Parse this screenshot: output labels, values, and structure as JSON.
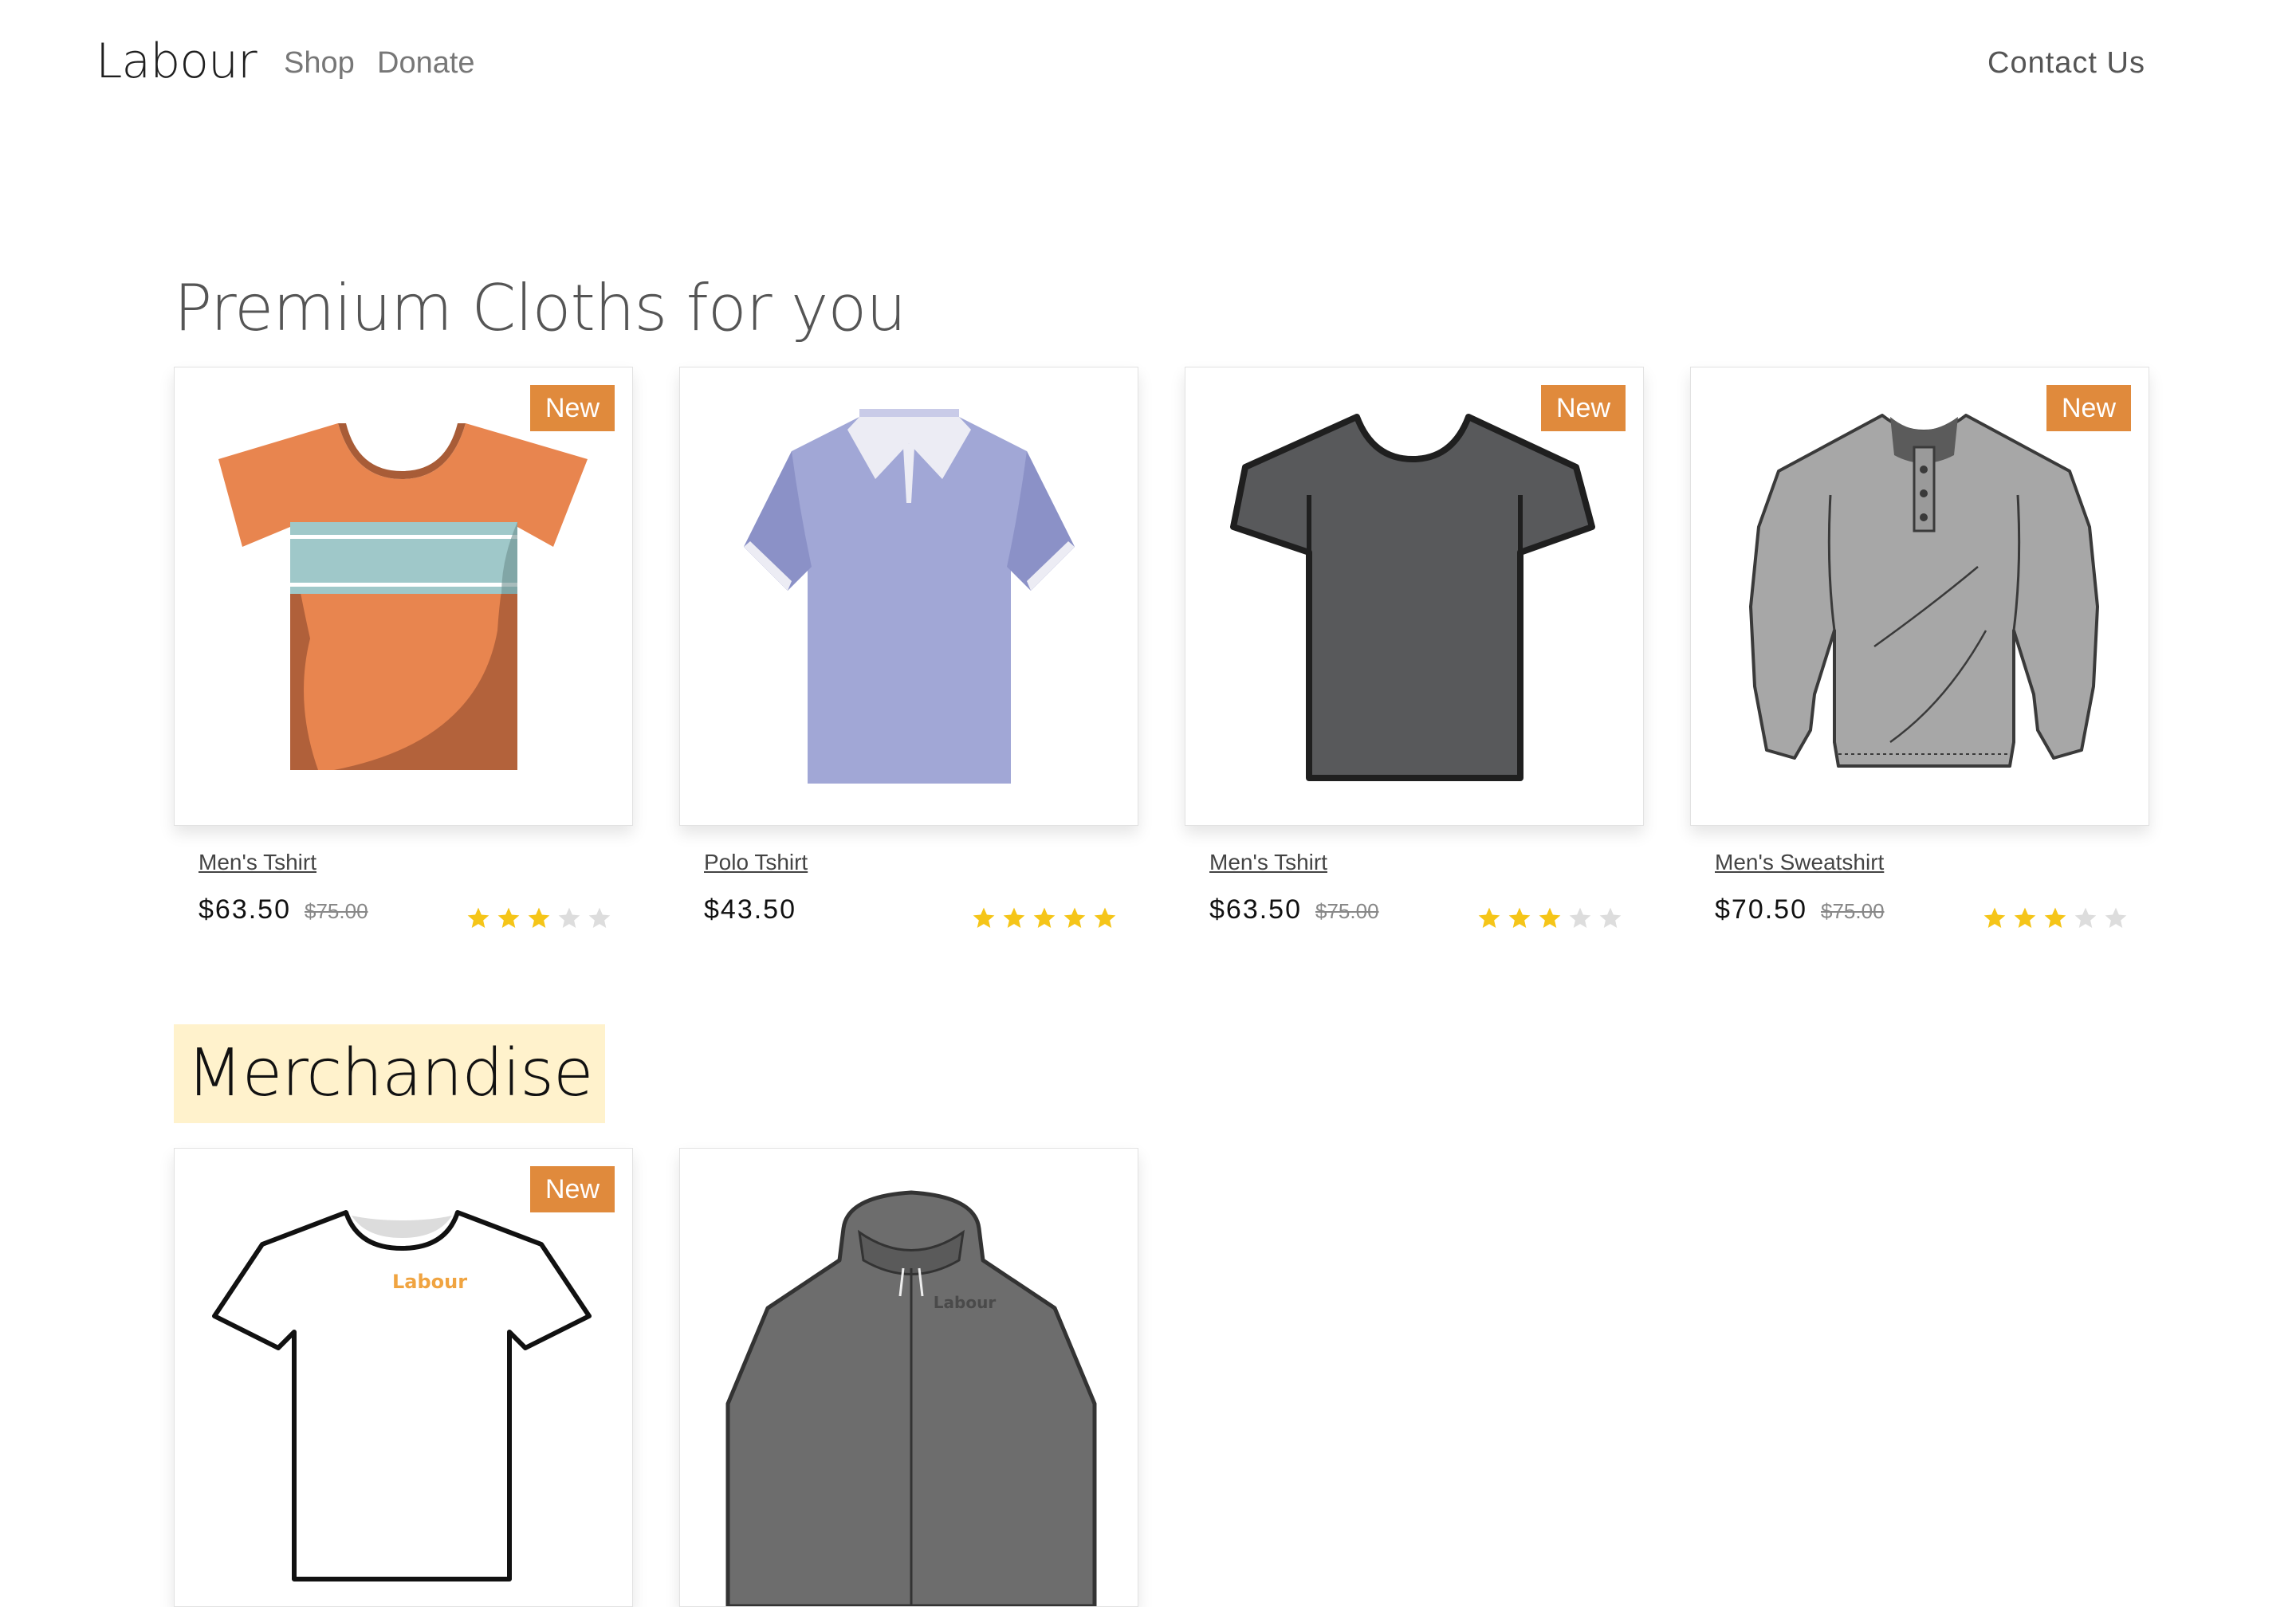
{
  "nav": {
    "brand": "Labour",
    "links": [
      "Shop",
      "Donate"
    ],
    "contact": "Contact Us"
  },
  "sections": {
    "premium_title": "Premium Cloths for you",
    "merch_title": "Merchandise"
  },
  "products": [
    {
      "name": "Men's Tshirt",
      "price": "$63.50",
      "old_price": "$75.00",
      "badge": "New",
      "rating": 3,
      "rating_max": 5,
      "icon": "orange-striped-tshirt"
    },
    {
      "name": "Polo Tshirt",
      "price": "$43.50",
      "old_price": "",
      "badge": "",
      "rating": 5,
      "rating_max": 5,
      "icon": "lavender-polo-shirt"
    },
    {
      "name": "Men's Tshirt",
      "price": "$63.50",
      "old_price": "$75.00",
      "badge": "New",
      "rating": 3,
      "rating_max": 5,
      "icon": "dark-gray-tshirt"
    },
    {
      "name": "Men's Sweatshirt",
      "price": "$70.50",
      "old_price": "$75.00",
      "badge": "New",
      "rating": 3,
      "rating_max": 5,
      "icon": "gray-sweatshirt"
    }
  ],
  "merch": [
    {
      "badge": "New",
      "print": "Labour",
      "icon": "white-labour-tshirt"
    },
    {
      "badge": "",
      "print": "Labour",
      "icon": "gray-labour-hoodie"
    }
  ],
  "colors": {
    "badge": "#e08a3c",
    "star_on": "#f5c518",
    "star_off": "#dddddd",
    "merch_highlight": "#fff2cc"
  }
}
